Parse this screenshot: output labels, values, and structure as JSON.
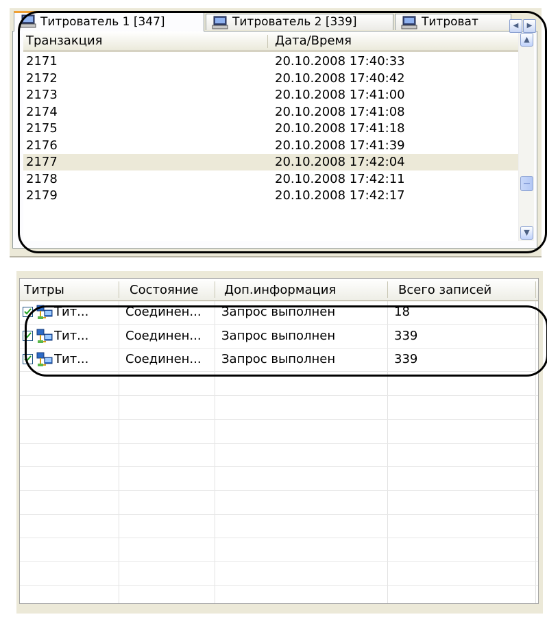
{
  "tabs": [
    {
      "label": "Титрователь 1 [347]",
      "active": true,
      "icon": "computer-icon"
    },
    {
      "label": "Титрователь 2 [339]",
      "active": false,
      "icon": "computer-icon"
    },
    {
      "label": "Титроват",
      "active": false,
      "icon": "computer-icon"
    }
  ],
  "tab_scroll": {
    "left_icon": "arrow-left-icon",
    "right_icon": "arrow-right-icon"
  },
  "transactions": {
    "headers": {
      "transaction": "Транзакция",
      "datetime": "Дата/Время"
    },
    "rows": [
      {
        "id": "2171",
        "datetime": "20.10.2008 17:40:33"
      },
      {
        "id": "2172",
        "datetime": "20.10.2008 17:40:42"
      },
      {
        "id": "2173",
        "datetime": "20.10.2008 17:41:00"
      },
      {
        "id": "2174",
        "datetime": "20.10.2008 17:41:08"
      },
      {
        "id": "2175",
        "datetime": "20.10.2008 17:41:18"
      },
      {
        "id": "2176",
        "datetime": "20.10.2008 17:41:39"
      },
      {
        "id": "2177",
        "datetime": "20.10.2008 17:42:04"
      },
      {
        "id": "2178",
        "datetime": "20.10.2008 17:42:11"
      },
      {
        "id": "2179",
        "datetime": "20.10.2008 17:42:17"
      }
    ],
    "selected_row": "2177"
  },
  "status_table": {
    "headers": {
      "titry": "Титры",
      "state": "Состояние",
      "info": "Доп.информация",
      "total": "Всего записей"
    },
    "rows": [
      {
        "checked": true,
        "name": "Тит...",
        "state": "Соединен...",
        "info": "Запрос выполнен",
        "total": "18"
      },
      {
        "checked": true,
        "name": "Тит...",
        "state": "Соединен...",
        "info": "Запрос выполнен",
        "total": "339"
      },
      {
        "checked": true,
        "name": "Тит...",
        "state": "Соединен...",
        "info": "Запрос выполнен",
        "total": "339"
      }
    ]
  },
  "colors": {
    "panel_bg": "#ece9d8",
    "active_tab_accent": "#f1a033",
    "selection": "#ece9d8"
  }
}
